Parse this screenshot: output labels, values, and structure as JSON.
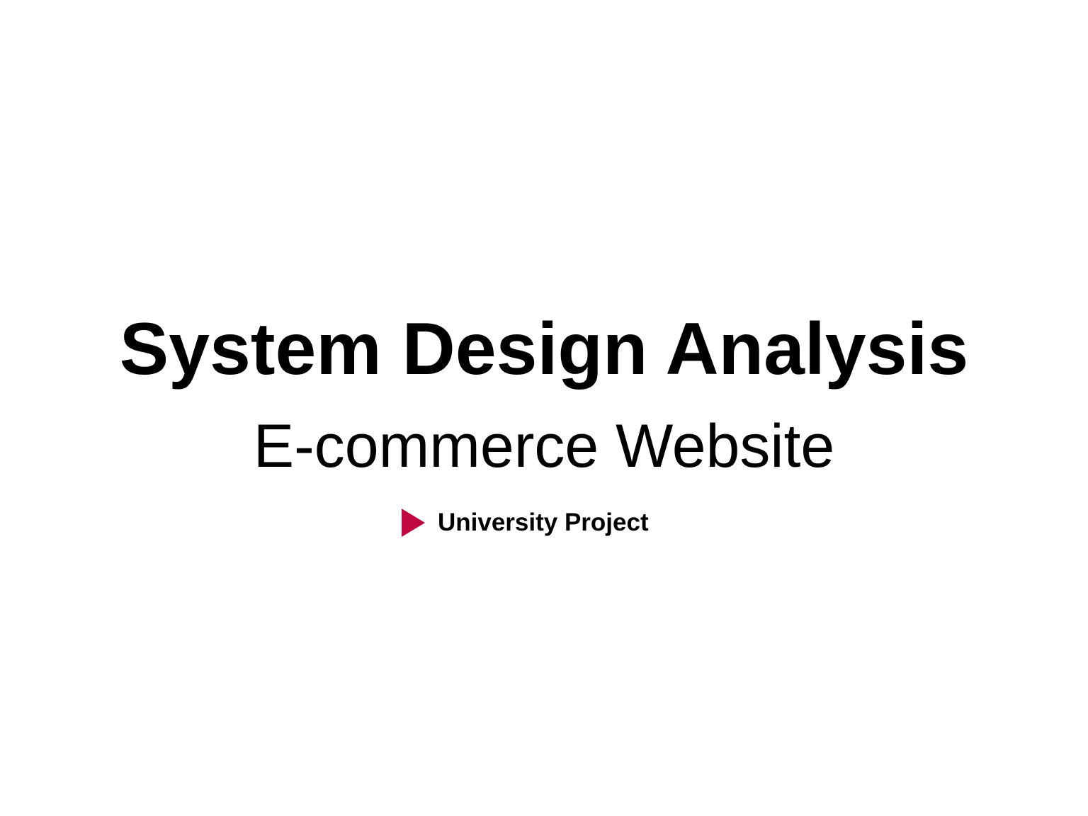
{
  "slide": {
    "title": "System Design Analysis",
    "subtitle": "E-commerce Website",
    "tag": {
      "label": "University Project",
      "icon": "play-triangle-icon",
      "icon_color": "#c0073f"
    }
  },
  "colors": {
    "background": "#ffffff",
    "text": "#000000",
    "accent": "#c0073f"
  }
}
